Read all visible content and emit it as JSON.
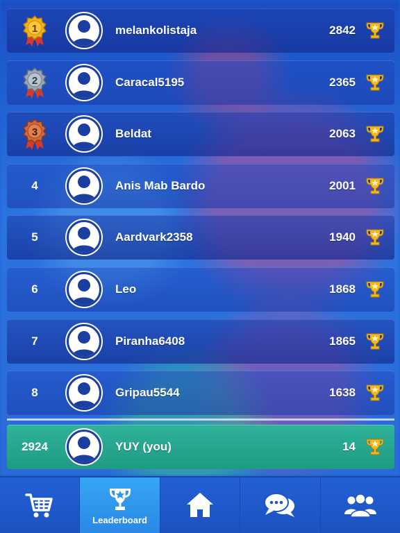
{
  "leaderboard": {
    "rows": [
      {
        "rank": "1",
        "name": "melankolistaja",
        "score": "2842",
        "medal": "gold-medal-icon"
      },
      {
        "rank": "2",
        "name": "Caracal5195",
        "score": "2365",
        "medal": "silver-medal-icon"
      },
      {
        "rank": "3",
        "name": "Beldat",
        "score": "2063",
        "medal": "bronze-medal-icon"
      },
      {
        "rank": "4",
        "name": "Anis Mab Bardo",
        "score": "2001"
      },
      {
        "rank": "5",
        "name": "Aardvark2358",
        "score": "1940"
      },
      {
        "rank": "6",
        "name": "Leo",
        "score": "1868"
      },
      {
        "rank": "7",
        "name": "Piranha6408",
        "score": "1865"
      },
      {
        "rank": "8",
        "name": "Gripau5544",
        "score": "1638"
      }
    ],
    "you": {
      "rank": "2924",
      "name": "YUY (you)",
      "score": "14"
    }
  },
  "nav": {
    "shop_icon": "cart-icon",
    "leaderboard_icon": "trophy-icon",
    "leaderboard_label": "Leaderboard",
    "home_icon": "home-icon",
    "chat_icon": "chat-icon",
    "friends_icon": "friends-icon"
  },
  "colors": {
    "background": "#1b5fd0",
    "row": "#1e3c9a",
    "you_row": "#2fb39a",
    "active_tab": "#35a6f4",
    "gold": "#f2b21e",
    "silver": "#9aa8b5",
    "bronze": "#d2673a"
  }
}
